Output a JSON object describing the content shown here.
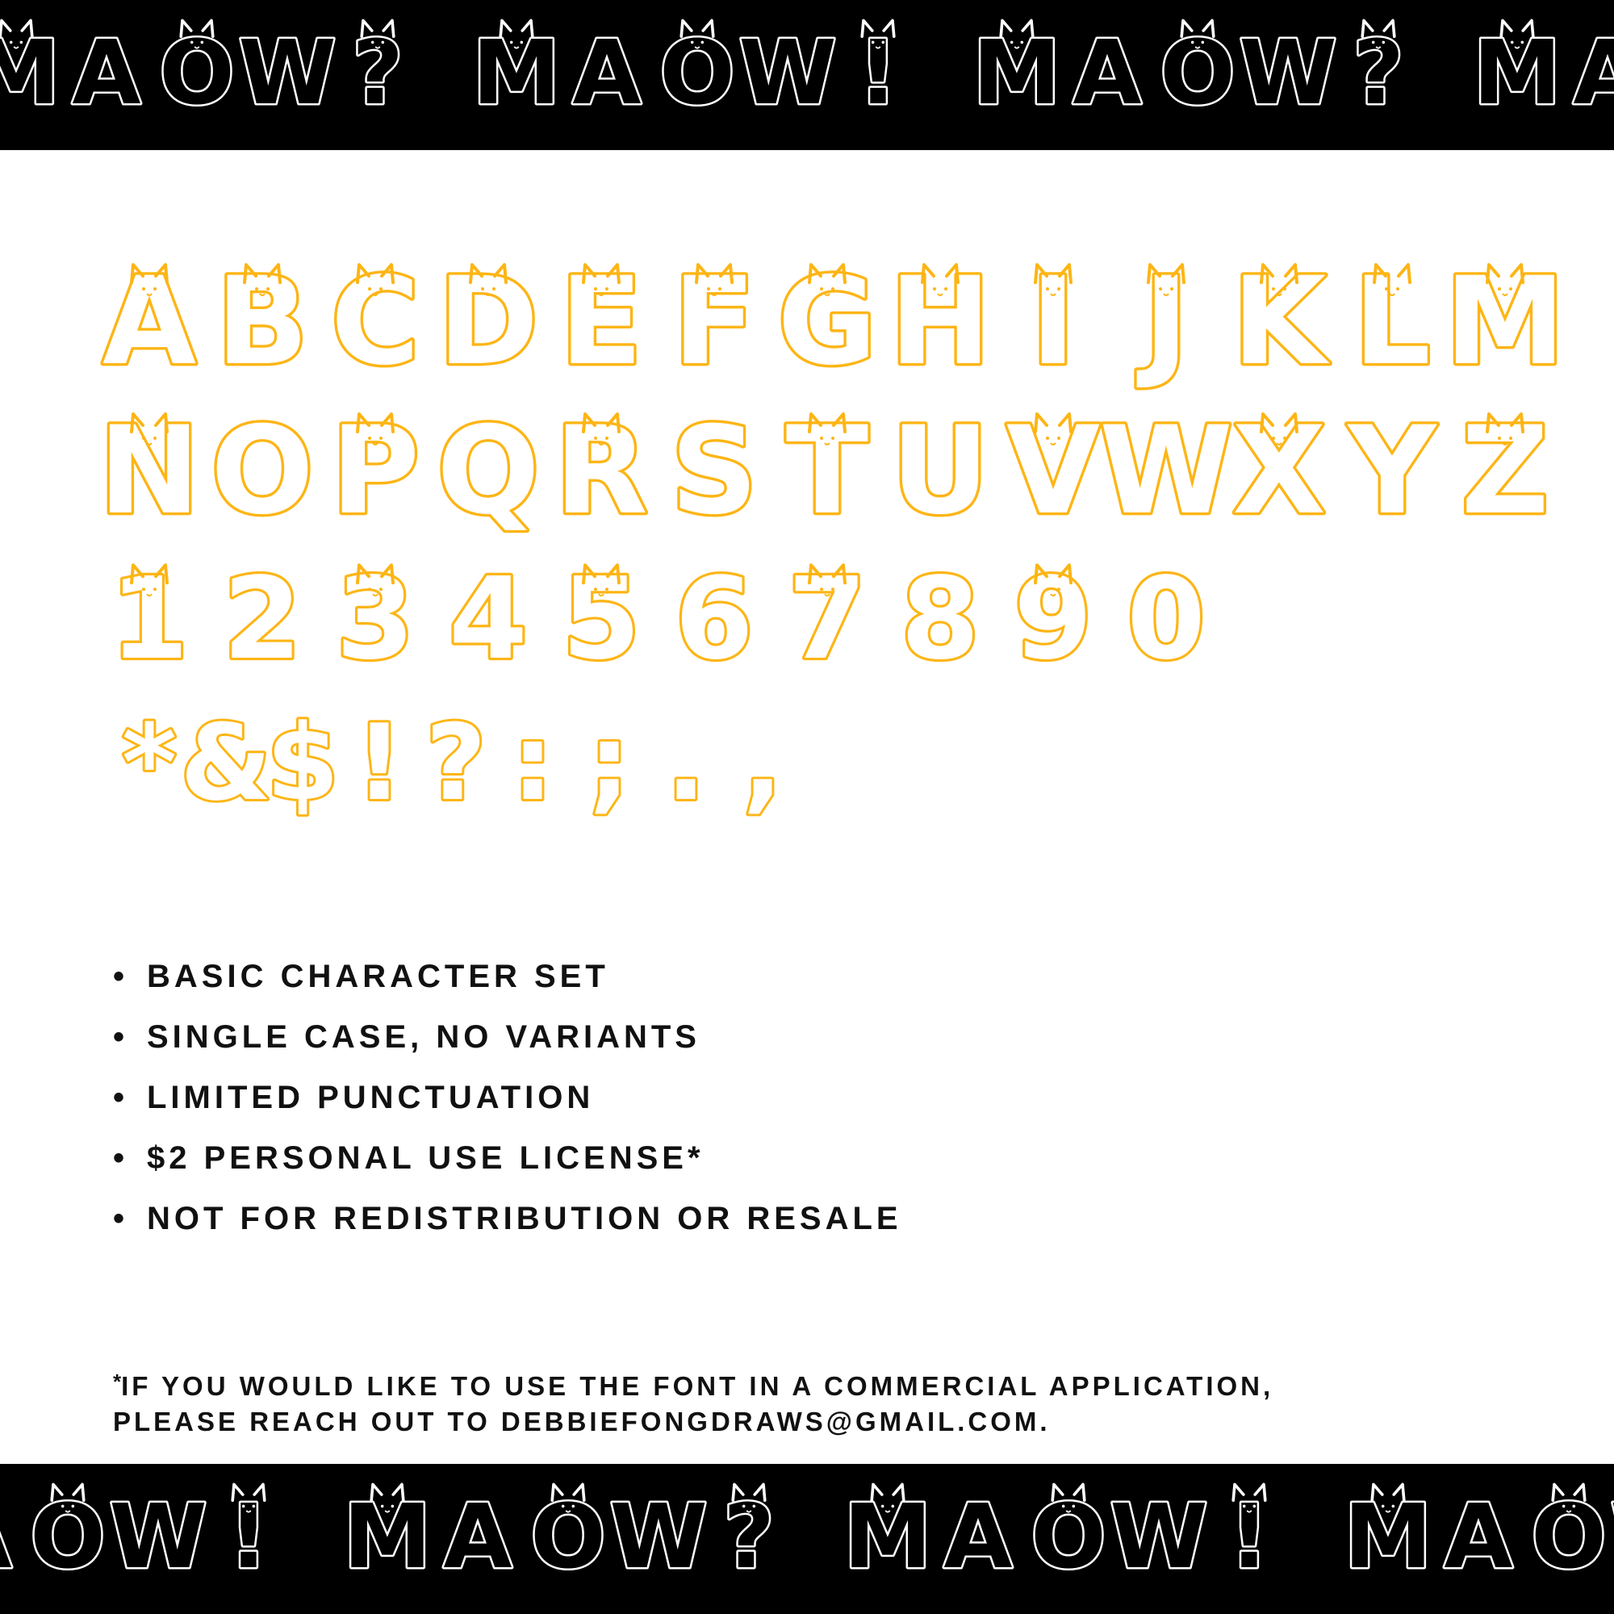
{
  "banner_top": {
    "words": [
      "MAOW?",
      "MAOW!",
      "MAOW?",
      "MAOW!"
    ]
  },
  "banner_bottom": {
    "words": [
      "MAOW!",
      "MAOW?",
      "MAOW!",
      "MAOW"
    ]
  },
  "glyph_rows": [
    [
      "A",
      "B",
      "C",
      "D",
      "E",
      "F",
      "G",
      "H",
      "I",
      "J",
      "K",
      "L",
      "M"
    ],
    [
      "N",
      "O",
      "P",
      "Q",
      "R",
      "S",
      "T",
      "U",
      "V",
      "W",
      "X",
      "Y",
      "Z"
    ],
    [
      "1",
      "2",
      "3",
      "4",
      "5",
      "6",
      "7",
      "8",
      "9",
      "0"
    ],
    [
      "*",
      "&",
      "$",
      "!",
      "?",
      ":",
      ";",
      ".",
      ","
    ]
  ],
  "features": [
    {
      "text": "BASIC CHARACTER SET"
    },
    {
      "text": "SINGLE CASE, NO VARIANTS"
    },
    {
      "text": "LIMITED PUNCTUATION"
    },
    {
      "text": "$2 PERSONAL USE LICENSE*"
    },
    {
      "text": "NOT FOR REDISTRIBUTION OR RESALE"
    }
  ],
  "bullet": "•",
  "footnote": {
    "asterisk": "*",
    "line1": "IF YOU WOULD LIKE TO USE THE FONT IN A COMMERCIAL APPLICATION,",
    "line2": "PLEASE REACH OUT TO DEBBIEFONGDRAWS@GMAIL.COM."
  },
  "colors": {
    "glyph_outline": "#FDB515",
    "banner_background": "#000000",
    "banner_outline": "#FFFFFF",
    "text": "#111111"
  }
}
